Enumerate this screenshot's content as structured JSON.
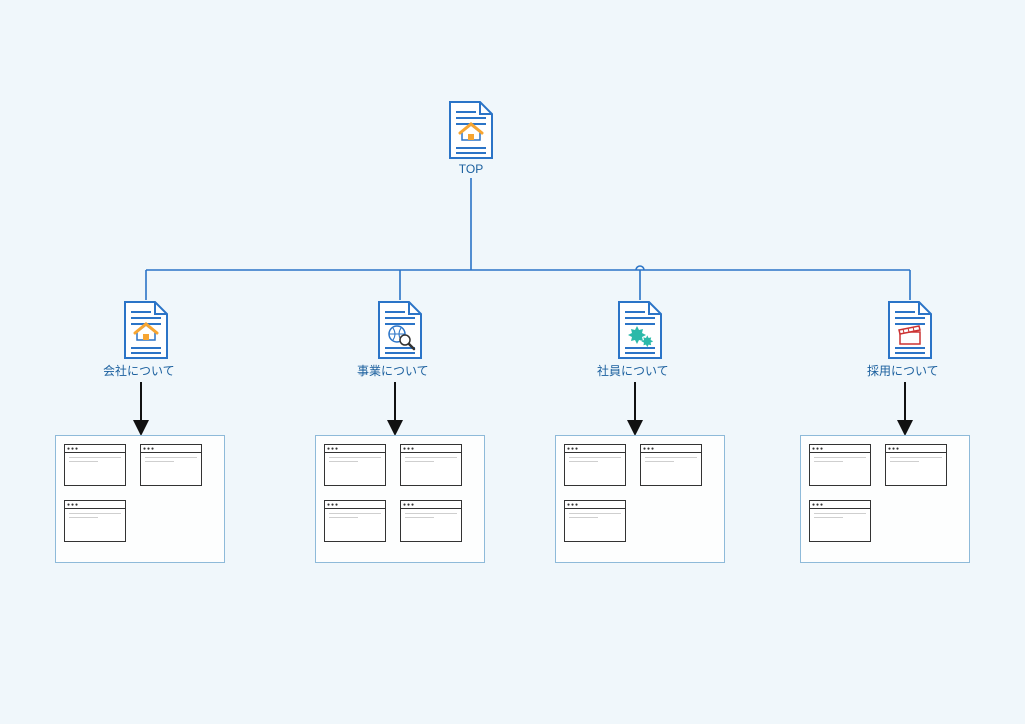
{
  "diagram": {
    "root": {
      "label": "TOP",
      "icon": "home-doc",
      "children": [
        {
          "id": "company",
          "label": "会社について",
          "icon": "home-doc",
          "subpages": 3
        },
        {
          "id": "business",
          "label": "事業について",
          "icon": "search-doc",
          "subpages": 4
        },
        {
          "id": "staff",
          "label": "社員について",
          "icon": "gear-doc",
          "subpages": 3
        },
        {
          "id": "recruit",
          "label": "採用について",
          "icon": "video-doc",
          "subpages": 3
        }
      ]
    }
  },
  "colors": {
    "stroke": "#2b74c7",
    "accent": "#f7a531",
    "teal": "#2bb9a9",
    "red": "#c33",
    "text": "#1a5f9e",
    "box_border": "#8ebad9"
  }
}
